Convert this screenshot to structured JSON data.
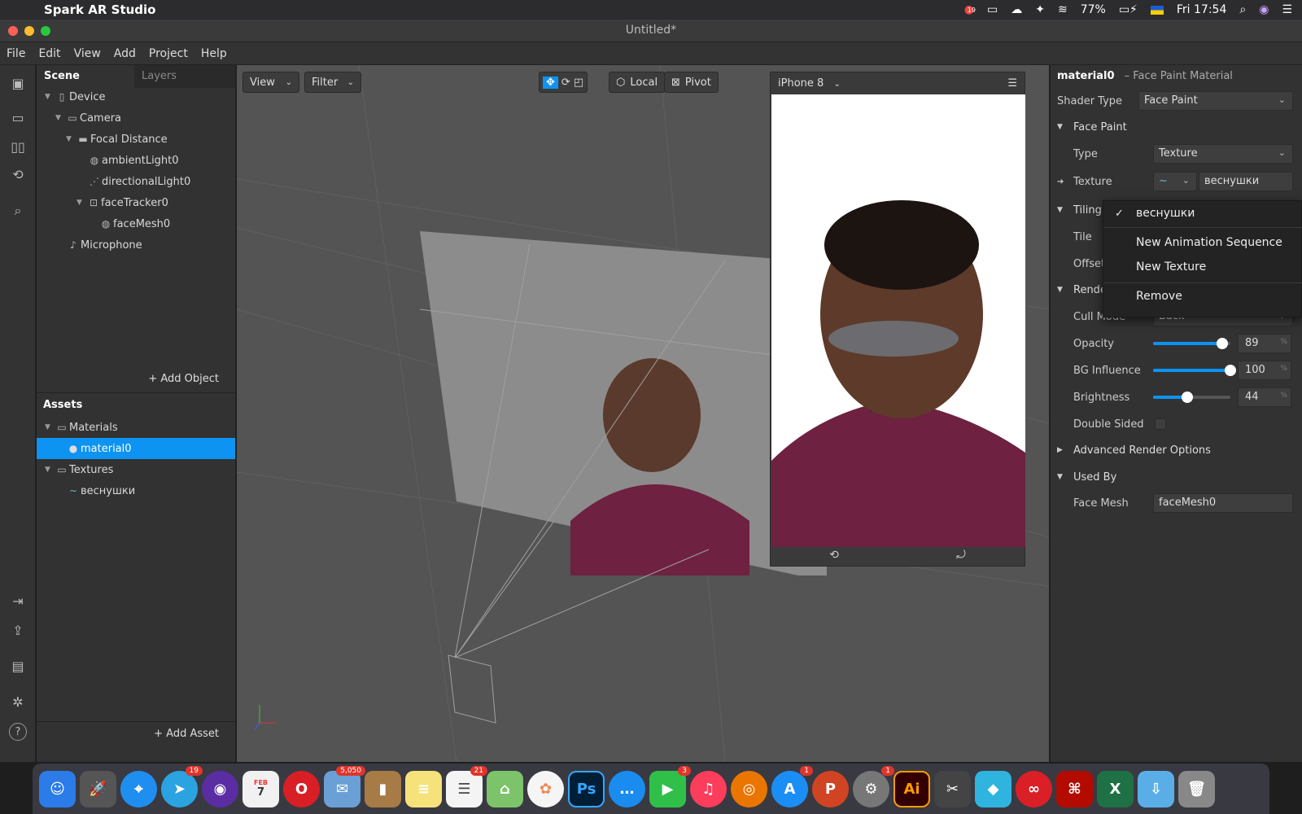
{
  "menubar": {
    "app_name": "Spark AR Studio",
    "battery": "77%",
    "clock": "Fri 17:54",
    "notif_badge": "19"
  },
  "window": {
    "title": "Untitled*"
  },
  "app_menu": [
    "File",
    "Edit",
    "View",
    "Add",
    "Project",
    "Help"
  ],
  "scene": {
    "tab_scene": "Scene",
    "tab_layers": "Layers",
    "items": [
      {
        "label": "Device"
      },
      {
        "label": "Camera"
      },
      {
        "label": "Focal Distance"
      },
      {
        "label": "ambientLight0"
      },
      {
        "label": "directionalLight0"
      },
      {
        "label": "faceTracker0"
      },
      {
        "label": "faceMesh0"
      },
      {
        "label": "Microphone"
      }
    ],
    "add_object": "Add Object"
  },
  "assets": {
    "title": "Assets",
    "items": [
      {
        "label": "Materials"
      },
      {
        "label": "material0"
      },
      {
        "label": "Textures"
      },
      {
        "label": "веснушки"
      }
    ],
    "add_asset": "Add Asset"
  },
  "viewport": {
    "view_btn": "View",
    "filter_btn": "Filter",
    "local_btn": "Local",
    "pivot_btn": "Pivot",
    "device": "iPhone 8"
  },
  "inspector": {
    "name": "material0",
    "type": "– Face Paint Material",
    "shader_label": "Shader Type",
    "shader_value": "Face Paint",
    "face_paint_section": "Face Paint",
    "type_label": "Type",
    "type_value": "Texture",
    "texture_label": "Texture",
    "texture_value": "веснушки",
    "tiling_section": "Tiling",
    "tile_label": "Tile",
    "offset_label": "Offset",
    "render_section": "Rende",
    "cull_label": "Cull Mode",
    "cull_value": "Back",
    "opacity_label": "Opacity",
    "opacity_value": "89",
    "opacity_level": 0.89,
    "bg_label": "BG Influence",
    "bg_value": "100",
    "bg_level": 1.0,
    "brightness_label": "Brightness",
    "brightness_value": "44",
    "brightness_level": 0.44,
    "double_label": "Double Sided",
    "adv_section": "Advanced Render Options",
    "usedby_section": "Used By",
    "facemesh_label": "Face Mesh",
    "facemesh_value": "faceMesh0",
    "pct": "%"
  },
  "popup": {
    "items": [
      "веснушки",
      "New Animation Sequence",
      "New Texture",
      "Remove"
    ],
    "check": "✓"
  },
  "dock": {
    "badges": {
      "telegram": "19",
      "mail": "5,050",
      "reminders": "21",
      "facetime": "3",
      "appstore": "1",
      "prefs": "1"
    },
    "calendar_month": "FEB",
    "calendar_day": "7",
    "ps": "Ps",
    "ai": "Ai"
  }
}
